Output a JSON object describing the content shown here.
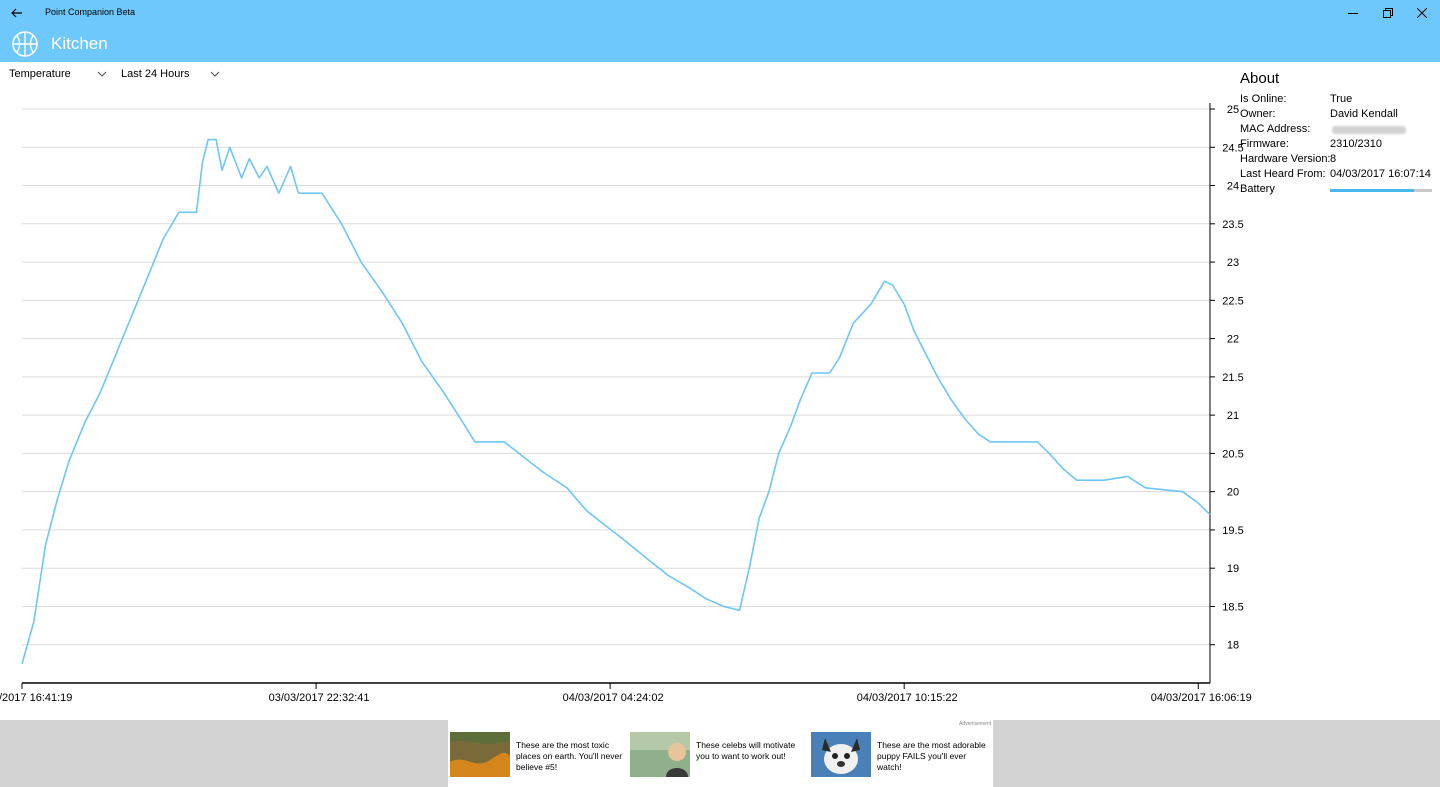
{
  "titlebar": {
    "app_title": "Point Companion Beta"
  },
  "header": {
    "room": "Kitchen"
  },
  "controls": {
    "metric": "Temperature",
    "range": "Last 24 Hours"
  },
  "chart_data": {
    "type": "line",
    "title": "",
    "xlabel": "",
    "ylabel": "",
    "ylim": [
      17.5,
      25
    ],
    "x_tick_labels": [
      "/2017 16:41:19",
      "03/03/2017 22:32:41",
      "04/03/2017 04:24:02",
      "04/03/2017 10:15:22",
      "04/03/2017 16:06:19"
    ],
    "y_ticks": [
      "18",
      "18.5",
      "19",
      "19.5",
      "20",
      "20.5",
      "21",
      "21.5",
      "22",
      "22.5",
      "23",
      "23.5",
      "24",
      "24.5",
      "25"
    ],
    "series": [
      {
        "color": "#6ec6f5",
        "points": [
          [
            0,
            17.75
          ],
          [
            0.3,
            18.3
          ],
          [
            0.6,
            19.3
          ],
          [
            0.9,
            19.9
          ],
          [
            1.2,
            20.4
          ],
          [
            1.6,
            20.9
          ],
          [
            2.0,
            21.3
          ],
          [
            2.4,
            21.8
          ],
          [
            2.8,
            22.3
          ],
          [
            3.2,
            22.8
          ],
          [
            3.6,
            23.3
          ],
          [
            4.0,
            23.65
          ],
          [
            4.45,
            23.65
          ],
          [
            4.6,
            24.3
          ],
          [
            4.75,
            24.6
          ],
          [
            4.95,
            24.6
          ],
          [
            5.1,
            24.2
          ],
          [
            5.3,
            24.5
          ],
          [
            5.6,
            24.1
          ],
          [
            5.8,
            24.35
          ],
          [
            6.05,
            24.1
          ],
          [
            6.25,
            24.25
          ],
          [
            6.55,
            23.9
          ],
          [
            6.85,
            24.25
          ],
          [
            7.05,
            23.9
          ],
          [
            7.65,
            23.9
          ],
          [
            8.15,
            23.5
          ],
          [
            8.65,
            23.0
          ],
          [
            9.2,
            22.6
          ],
          [
            9.7,
            22.2
          ],
          [
            10.2,
            21.7
          ],
          [
            10.75,
            21.3
          ],
          [
            11.25,
            20.9
          ],
          [
            11.55,
            20.65
          ],
          [
            12.3,
            20.65
          ],
          [
            12.8,
            20.45
          ],
          [
            13.3,
            20.25
          ],
          [
            13.9,
            20.05
          ],
          [
            14.4,
            19.75
          ],
          [
            14.9,
            19.55
          ],
          [
            15.4,
            19.35
          ],
          [
            16.0,
            19.1
          ],
          [
            16.5,
            18.9
          ],
          [
            17.0,
            18.75
          ],
          [
            17.45,
            18.6
          ],
          [
            17.9,
            18.5
          ],
          [
            18.3,
            18.45
          ],
          [
            18.55,
            19.0
          ],
          [
            18.8,
            19.65
          ],
          [
            19.05,
            20.0
          ],
          [
            19.3,
            20.5
          ],
          [
            19.6,
            20.85
          ],
          [
            19.85,
            21.2
          ],
          [
            20.15,
            21.55
          ],
          [
            20.6,
            21.55
          ],
          [
            20.85,
            21.75
          ],
          [
            21.2,
            22.2
          ],
          [
            21.65,
            22.45
          ],
          [
            22.0,
            22.75
          ],
          [
            22.2,
            22.7
          ],
          [
            22.5,
            22.45
          ],
          [
            22.75,
            22.1
          ],
          [
            23.05,
            21.8
          ],
          [
            23.35,
            21.5
          ],
          [
            23.7,
            21.2
          ],
          [
            24.05,
            20.95
          ],
          [
            24.4,
            20.75
          ],
          [
            24.7,
            20.65
          ],
          [
            25.9,
            20.65
          ],
          [
            26.2,
            20.5
          ],
          [
            26.55,
            20.3
          ],
          [
            26.9,
            20.15
          ],
          [
            27.6,
            20.15
          ],
          [
            28.2,
            20.2
          ],
          [
            28.65,
            20.05
          ],
          [
            29.6,
            20.0
          ],
          [
            30.0,
            19.85
          ],
          [
            30.3,
            19.7
          ]
        ]
      }
    ],
    "x_range": [
      0,
      30.3
    ],
    "x_tick_positions": [
      0,
      7.5,
      15.0,
      22.5,
      30.0
    ]
  },
  "about": {
    "title": "About",
    "rows": [
      {
        "label": "Is Online:",
        "value": "True"
      },
      {
        "label": "Owner:",
        "value": "David Kendall"
      },
      {
        "label": "MAC Address:",
        "value": ""
      },
      {
        "label": "Firmware:",
        "value": "2310/2310"
      },
      {
        "label": "Hardware Version:",
        "value": "8"
      },
      {
        "label": "Last Heard From:",
        "value": "04/03/2017 16:07:14"
      },
      {
        "label": "Battery",
        "value": ""
      }
    ],
    "battery_level": 0.82
  },
  "ads": {
    "tag": "Advertisement",
    "items": [
      {
        "text": "These are the most toxic places on earth. You'll never believe #5!"
      },
      {
        "text": "These celebs will motivate you to want to work out!"
      },
      {
        "text": "These are the most adorable puppy FAILS you'll ever watch!"
      }
    ]
  }
}
